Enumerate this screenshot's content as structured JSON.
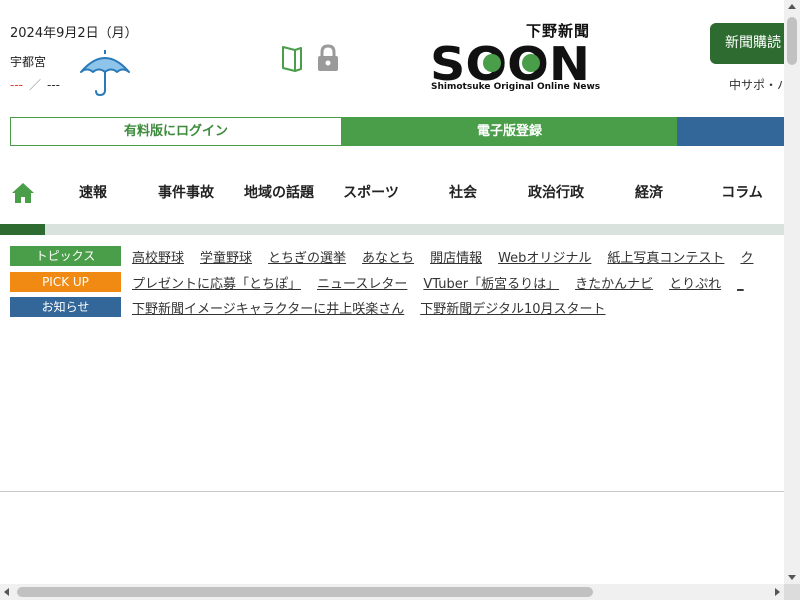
{
  "header": {
    "date": "2024年9月2日（月）",
    "city": "宇都宮",
    "temp_high": "---",
    "temp_separator": "／",
    "temp_low": "---",
    "weather_icon": "umbrella-icon",
    "logo_jp": "下野新聞",
    "logo_main": "SOON",
    "logo_en": "Shimotsuke Original Online News",
    "subscribe_label": "新聞購読",
    "support_label": "中サポ・ハ"
  },
  "login_bar": {
    "login_label": "有料版にログイン",
    "edition_label": "電子版登録"
  },
  "nav": {
    "items": [
      "速報",
      "事件事故",
      "地域の話題",
      "スポーツ",
      "社会",
      "政治行政",
      "経済",
      "コラム"
    ]
  },
  "rows": {
    "topics": {
      "label": "トピックス",
      "links": [
        "高校野球",
        "学童野球",
        "とちぎの選挙",
        "あなとち",
        "開店情報",
        "Webオリジナル",
        "紙上写真コンテスト",
        "ク"
      ]
    },
    "pickup": {
      "label": "PICK UP",
      "links": [
        "プレゼントに応募「とちぽ」",
        "ニュースレター",
        "VTuber「栃宮るりは」",
        "きたかんナビ",
        "とりぷれ",
        "_"
      ]
    },
    "notice": {
      "label": "お知らせ",
      "links": [
        "下野新聞イメージキャラクターに井上咲楽さん",
        "下野新聞デジタル10月スタート"
      ]
    }
  },
  "colors": {
    "brand_green": "#4a9e4a",
    "dark_green": "#2e6b30",
    "orange": "#f08a12",
    "blue": "#336699"
  }
}
